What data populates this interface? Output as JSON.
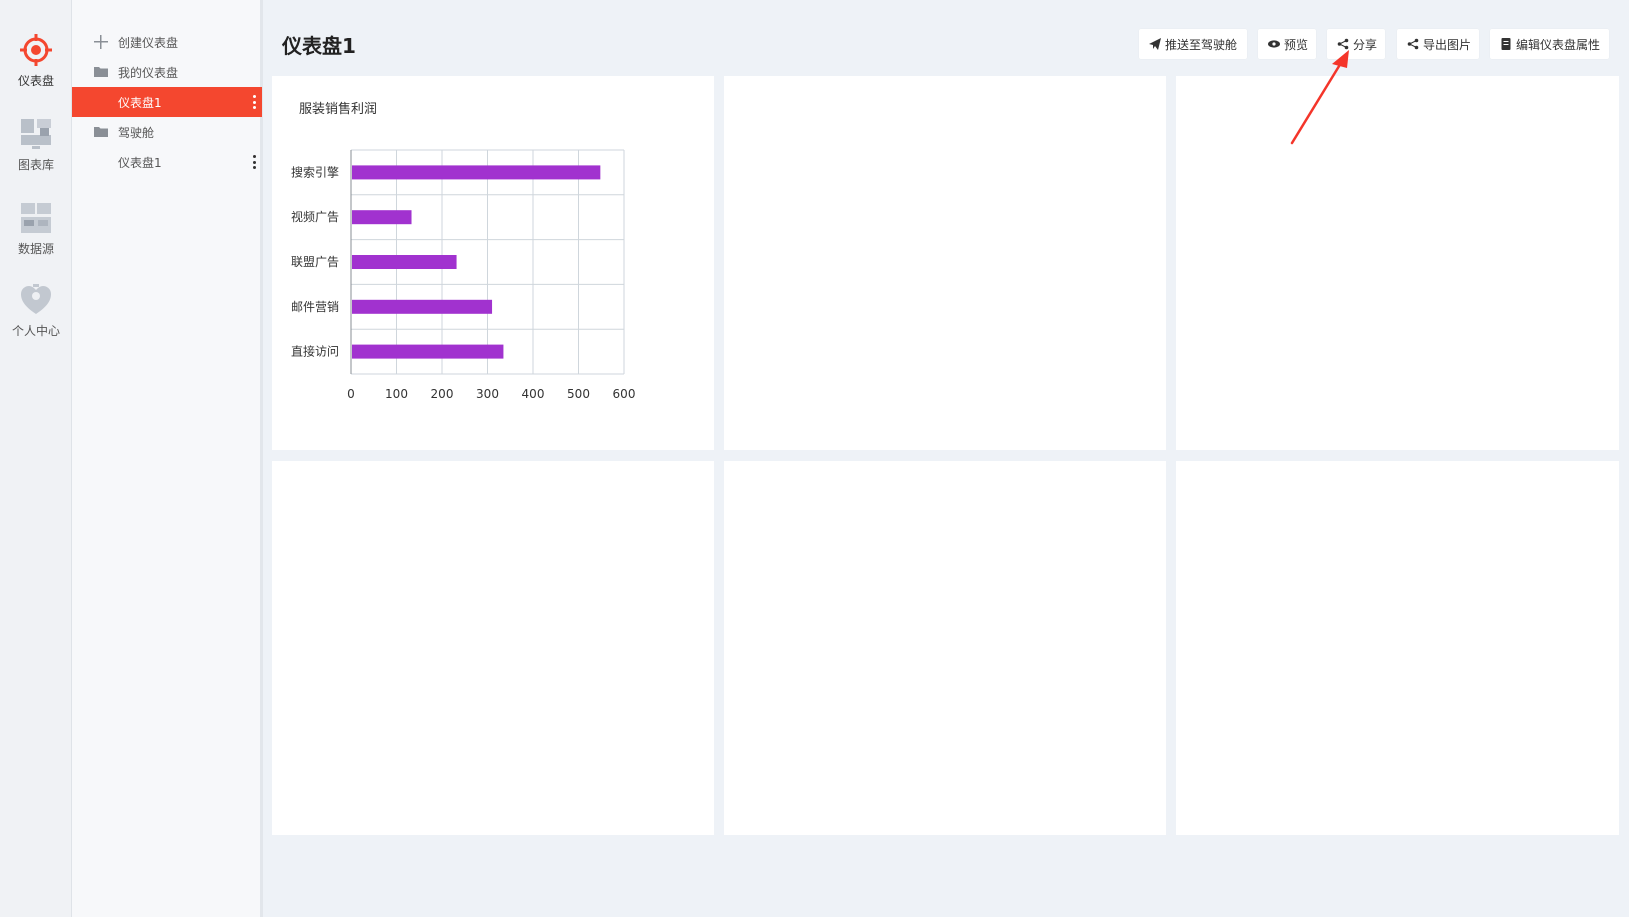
{
  "rail": {
    "items": [
      {
        "label": "仪表盘",
        "icon": "dashboard-target-icon"
      },
      {
        "label": "图表库",
        "icon": "chart-library-icon"
      },
      {
        "label": "数据源",
        "icon": "datasource-icon"
      },
      {
        "label": "个人中心",
        "icon": "user-heart-icon"
      }
    ],
    "accent": "#f4472f"
  },
  "tree": {
    "create_label": "创建仪表盘",
    "groups": [
      {
        "label": "我的仪表盘",
        "children": [
          {
            "label": "仪表盘1",
            "selected": true
          }
        ]
      },
      {
        "label": "驾驶舱",
        "children": [
          {
            "label": "仪表盘1",
            "selected": false
          }
        ]
      }
    ]
  },
  "header": {
    "title": "仪表盘1",
    "buttons": {
      "push": "推送至驾驶舱",
      "preview": "预览",
      "share": "分享",
      "export": "导出图片",
      "edit": "编辑仪表盘属性"
    }
  },
  "panels": {
    "chart_title": "服装销售利润"
  },
  "chart_data": {
    "type": "bar",
    "orientation": "horizontal",
    "title": "服装销售利润",
    "categories": [
      "搜索引擎",
      "视频广告",
      "联盟广告",
      "邮件营销",
      "直接访问"
    ],
    "values": [
      548,
      133,
      232,
      310,
      335
    ],
    "xlim": [
      0,
      600
    ],
    "xticks": [
      "0",
      "100",
      "200",
      "300",
      "400",
      "500",
      "600"
    ],
    "grid": true,
    "bar_color": "#a132cf"
  },
  "colors": {
    "selected_row": "#f4472f",
    "annotation_arrow": "#f4352a"
  }
}
